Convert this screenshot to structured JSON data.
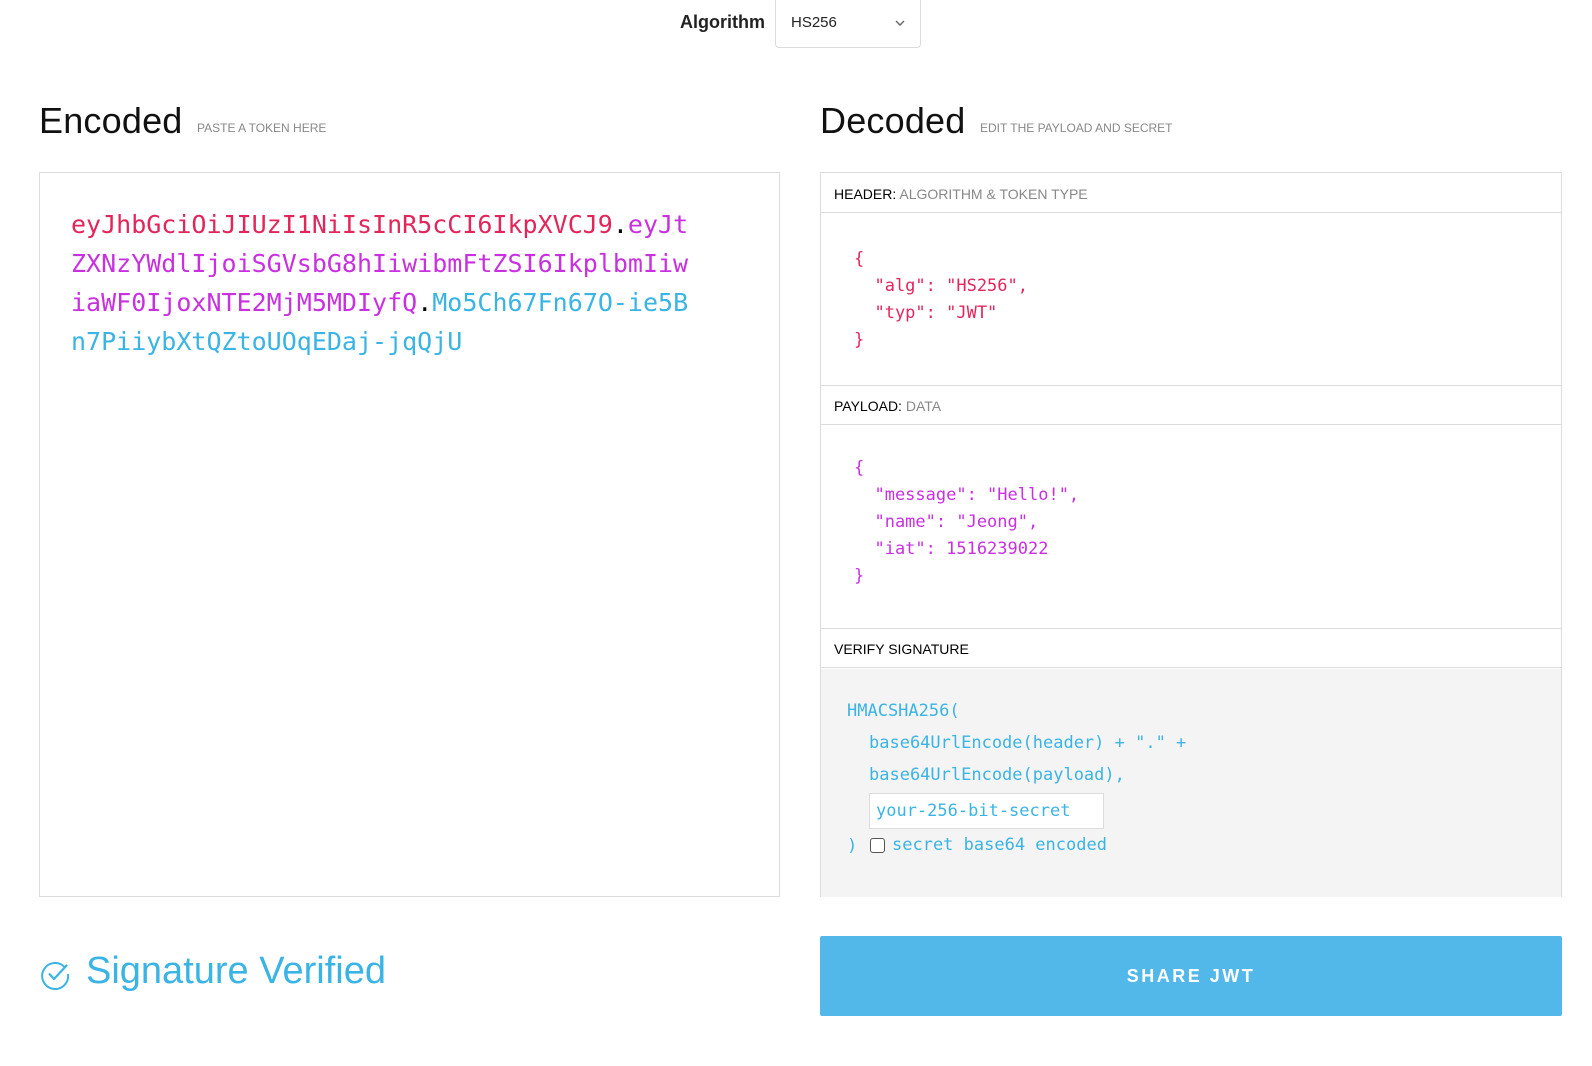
{
  "algorithm": {
    "label": "Algorithm",
    "selected": "HS256"
  },
  "encoded": {
    "title": "Encoded",
    "subtitle": "PASTE A TOKEN HERE",
    "token_header": "eyJhbGciOiJIUzI1NiIsInR5cCI6IkpXVCJ9",
    "token_payload": "eyJtZXNzYWdlIjoiSGVsbG8hIiwibmFtZSI6IkplbmIiwiaWF0IjoxNTE2MjM5MDIyfQ",
    "token_signature": "Mo5Ch67Fn67O-ie5Bn7PiiybXtQZtoUOqEDaj-jqQjU",
    "dot": "."
  },
  "decoded": {
    "title": "Decoded",
    "subtitle": "EDIT THE PAYLOAD AND SECRET",
    "header": {
      "label": "HEADER:",
      "sublabel": "ALGORITHM & TOKEN TYPE",
      "json_text": "{\n  \"alg\": \"HS256\",\n  \"typ\": \"JWT\"\n}"
    },
    "payload": {
      "label": "PAYLOAD:",
      "sublabel": "DATA",
      "json_text": "{\n  \"message\": \"Hello!\",\n  \"name\": \"Jeong\",\n  \"iat\": 1516239022\n}"
    },
    "verify": {
      "label": "VERIFY SIGNATURE",
      "fn_open": "HMACSHA256(",
      "line1": "base64UrlEncode(header) + \".\" +",
      "line2": "base64UrlEncode(payload),",
      "secret_value": "your-256-bit-secret",
      "fn_close": ")",
      "checkbox_label": "secret base64 encoded"
    }
  },
  "status": {
    "text": "Signature Verified"
  },
  "share_button": {
    "label": "SHARE JWT"
  },
  "colors": {
    "header": "#e2255a",
    "payload": "#c930e0",
    "signature": "#3ab4e4",
    "button": "#52b8ea"
  }
}
